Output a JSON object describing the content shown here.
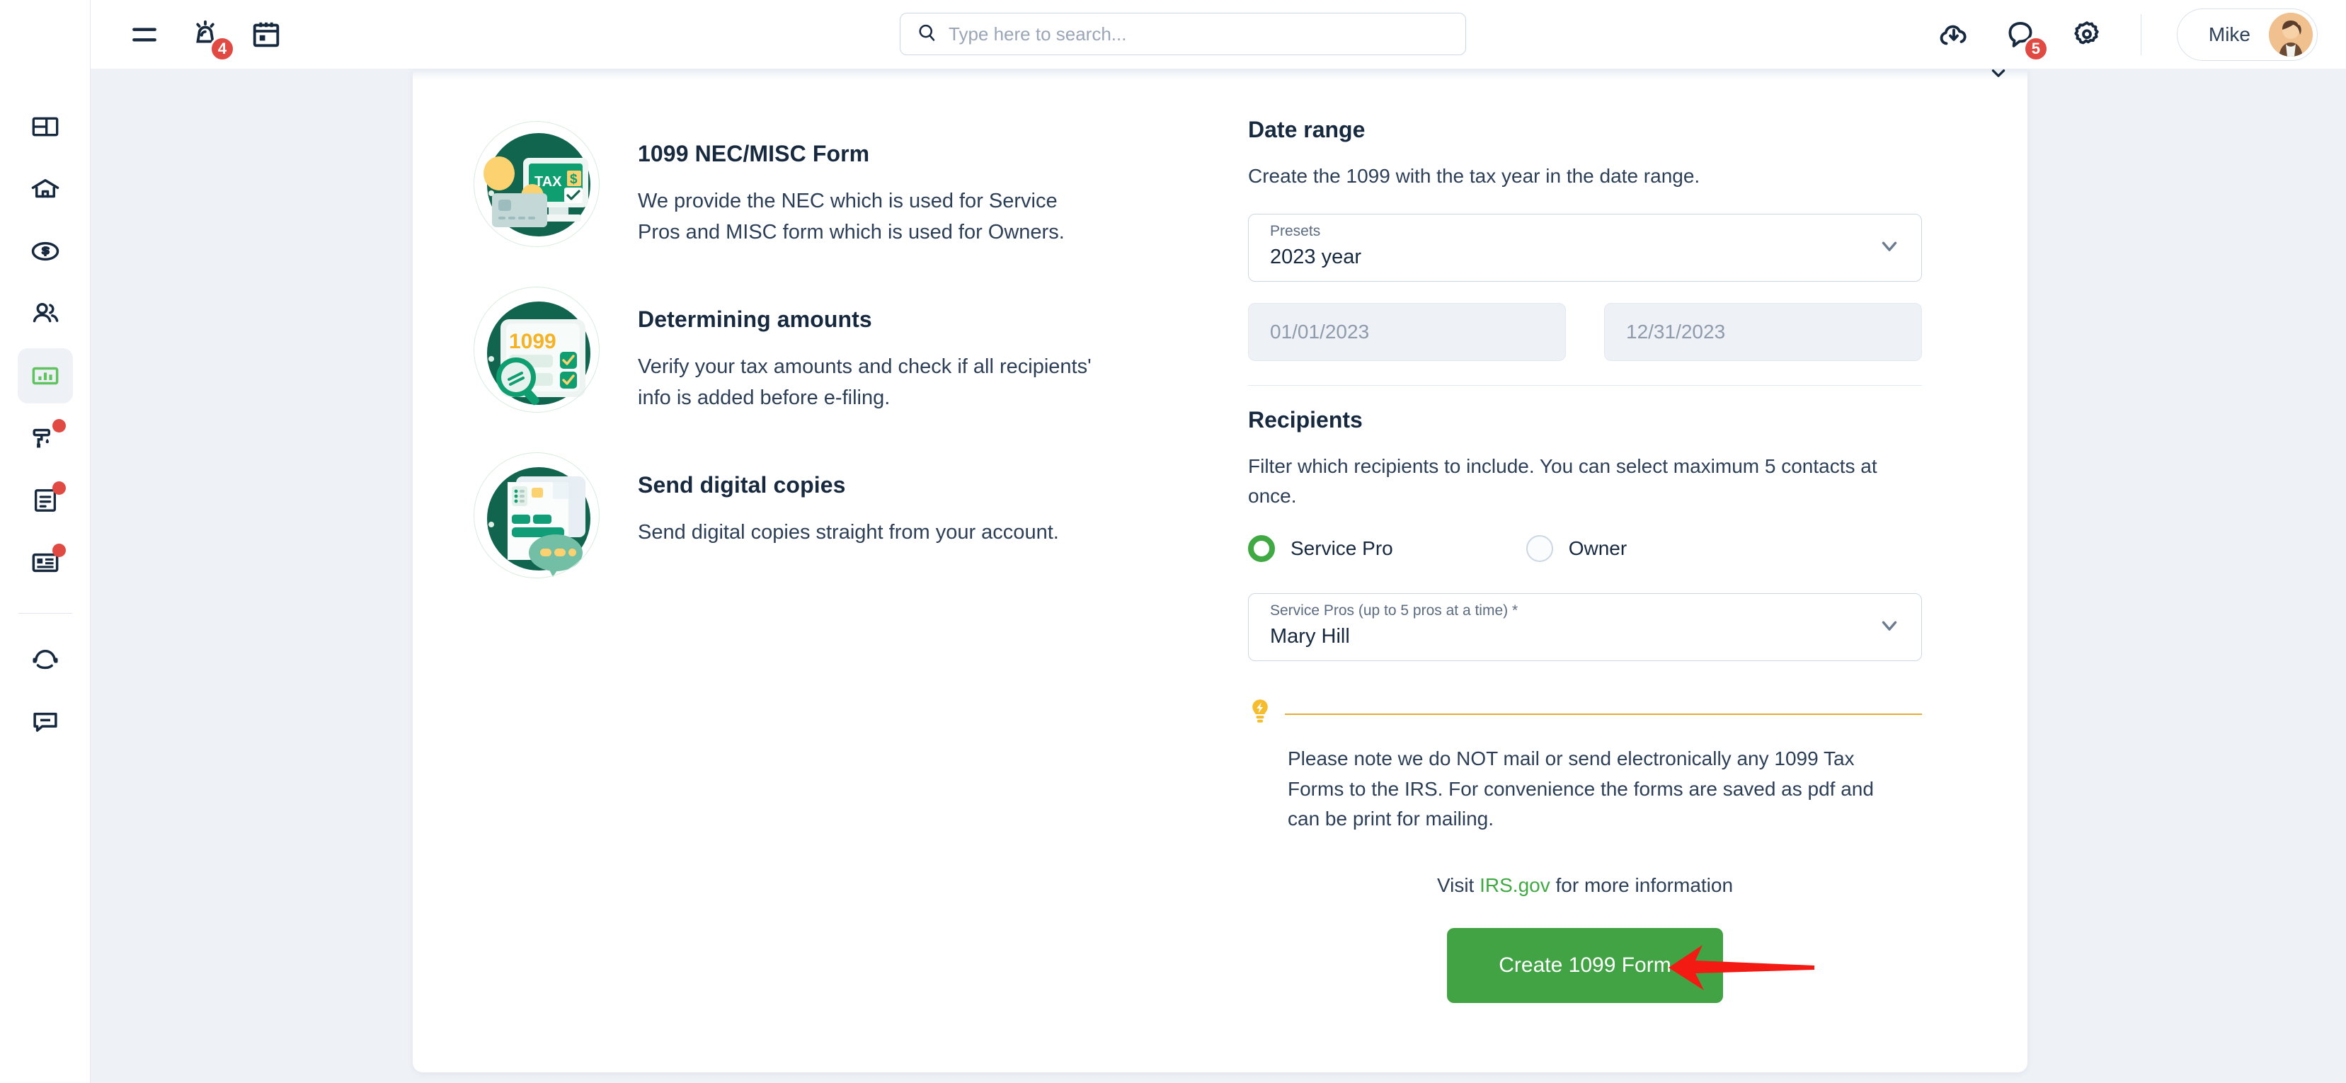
{
  "topbar": {
    "menu_icon": "hamburger-menu-icon",
    "alarm_icon": "alarm-bell-icon",
    "alarm_badge": "4",
    "calendar_icon": "calendar-icon",
    "search": {
      "placeholder": "Type here to search...",
      "value": "",
      "icon": "search-icon"
    },
    "download_icon": "cloud-download-icon",
    "chat_icon": "chat-bubble-icon",
    "chat_badge": "5",
    "settings_icon": "gear-icon",
    "user_name": "Mike",
    "avatar_icon": "user-avatar"
  },
  "sidebar": {
    "items": [
      {
        "name": "dashboard",
        "icon": "dashboard-layout-icon",
        "active": false,
        "badge": false
      },
      {
        "name": "properties",
        "icon": "home-icon",
        "active": false,
        "badge": false
      },
      {
        "name": "accounting",
        "icon": "dollar-coin-icon",
        "active": false,
        "badge": false
      },
      {
        "name": "people",
        "icon": "users-icon",
        "active": false,
        "badge": false
      },
      {
        "name": "reports",
        "icon": "bar-chart-icon",
        "active": true,
        "badge": false
      },
      {
        "name": "maintenance",
        "icon": "paint-roller-icon",
        "active": false,
        "badge": true
      },
      {
        "name": "documents",
        "icon": "document-icon",
        "active": false,
        "badge": true
      },
      {
        "name": "contacts",
        "icon": "id-card-icon",
        "active": false,
        "badge": true
      },
      {
        "name": "support",
        "icon": "headset-icon",
        "active": false,
        "badge": false
      },
      {
        "name": "messages",
        "icon": "message-icon",
        "active": false,
        "badge": false
      }
    ]
  },
  "features": [
    {
      "art": "tax-monitor-card-illustration",
      "title": "1099 NEC/MISC Form",
      "desc": "We provide the NEC which is used for Service Pros and MISC form which is used for Owners."
    },
    {
      "art": "1099-magnifier-illustration",
      "title": "Determining amounts",
      "desc": "Verify your tax amounts and check if all recipients' info is added before e-filing."
    },
    {
      "art": "digital-copies-illustration",
      "title": "Send digital copies",
      "desc": "Send digital copies straight from your account."
    }
  ],
  "date_range": {
    "title": "Date range",
    "desc": "Create the 1099 with the tax year in the date range.",
    "preset_label": "Presets",
    "preset_value": "2023 year",
    "start_date": "01/01/2023",
    "end_date": "12/31/2023",
    "caret_icon": "chevron-down-icon"
  },
  "recipients": {
    "title": "Recipients",
    "desc": "Filter which recipients to include. You can select maximum 5 contacts at once.",
    "options": [
      {
        "label": "Service Pro",
        "selected": true
      },
      {
        "label": "Owner",
        "selected": false
      }
    ],
    "select_label": "Service Pros (up to 5 pros at a time) *",
    "select_value": "Mary Hill",
    "caret_icon": "chevron-down-icon"
  },
  "callout": {
    "icon": "lightbulb-icon",
    "text": "Please note we do NOT mail or send electronically any 1099 Tax Forms to the IRS. For convenience the forms are saved as pdf and can be print for mailing."
  },
  "footer": {
    "visit_prefix": "Visit ",
    "visit_link": "IRS.gov",
    "visit_suffix": " for more information",
    "cta_label": "Create 1099 Form",
    "annotation_icon": "red-arrow-annotation"
  },
  "colors": {
    "accent_green": "#42a345",
    "brand_dark": "#17293f",
    "badge_red": "#e04a43",
    "callout_yellow": "#e8ab32",
    "page_bg": "#eef1f6",
    "annotation_red": "#f41a14"
  }
}
